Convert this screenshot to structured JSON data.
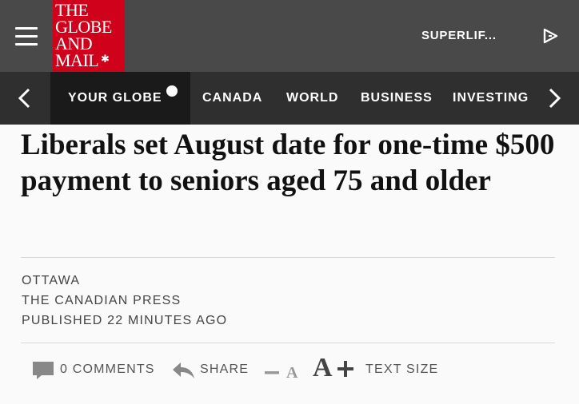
{
  "header": {
    "logo_lines": [
      "THE",
      "GLOBE",
      "AND",
      "MAIL"
    ],
    "logo_mark": "maple-leaf-icon",
    "menu_icon": "hamburger-menu-icon",
    "section_label": "SUPERLIF...",
    "action_icon": "play-icon",
    "brand_color": "#d0021b"
  },
  "nav": {
    "prev_icon": "chevron-left-icon",
    "next_icon": "chevron-right-icon",
    "items": [
      {
        "label": "YOUR GLOBE",
        "active": true
      },
      {
        "label": "CANADA"
      },
      {
        "label": "WORLD"
      },
      {
        "label": "BUSINESS"
      },
      {
        "label": "INVESTING"
      }
    ]
  },
  "article": {
    "headline": "Liberals set August date for one-time $500 payment to seniors aged 75 and older",
    "dateline": "OTTAWA",
    "source": "THE CANADIAN PRESS",
    "published": "PUBLISHED 22 MINUTES AGO"
  },
  "toolbar": {
    "comments_label": "0 COMMENTS",
    "share_label": "SHARE",
    "decrease_label": "A",
    "increase_label": "A",
    "text_size_label": "TEXT SIZE"
  }
}
